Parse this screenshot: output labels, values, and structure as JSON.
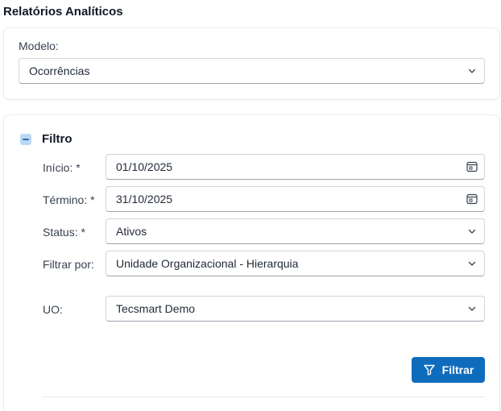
{
  "page": {
    "title": "Relatórios Analíticos"
  },
  "model": {
    "label": "Modelo:",
    "value": "Ocorrências"
  },
  "filter": {
    "title": "Filtro",
    "fields": {
      "inicio": {
        "label": "Início: *",
        "value": "01/10/2025",
        "icon": "calendar-icon"
      },
      "termino": {
        "label": "Término: *",
        "value": "31/10/2025",
        "icon": "calendar-icon"
      },
      "status": {
        "label": "Status: *",
        "value": "Ativos",
        "icon": "chevron-down-icon"
      },
      "filtrar_por": {
        "label": "Filtrar por:",
        "value": "Unidade Organizacional - Hierarquia",
        "icon": "chevron-down-icon"
      },
      "uo": {
        "label": "UO:",
        "value": "Tecsmart Demo",
        "icon": "chevron-down-icon"
      }
    },
    "button": {
      "label": "Filtrar",
      "icon": "funnel-icon"
    }
  },
  "colors": {
    "accent": "#0f6cbd",
    "toggle_bg": "#bcd7f5"
  }
}
